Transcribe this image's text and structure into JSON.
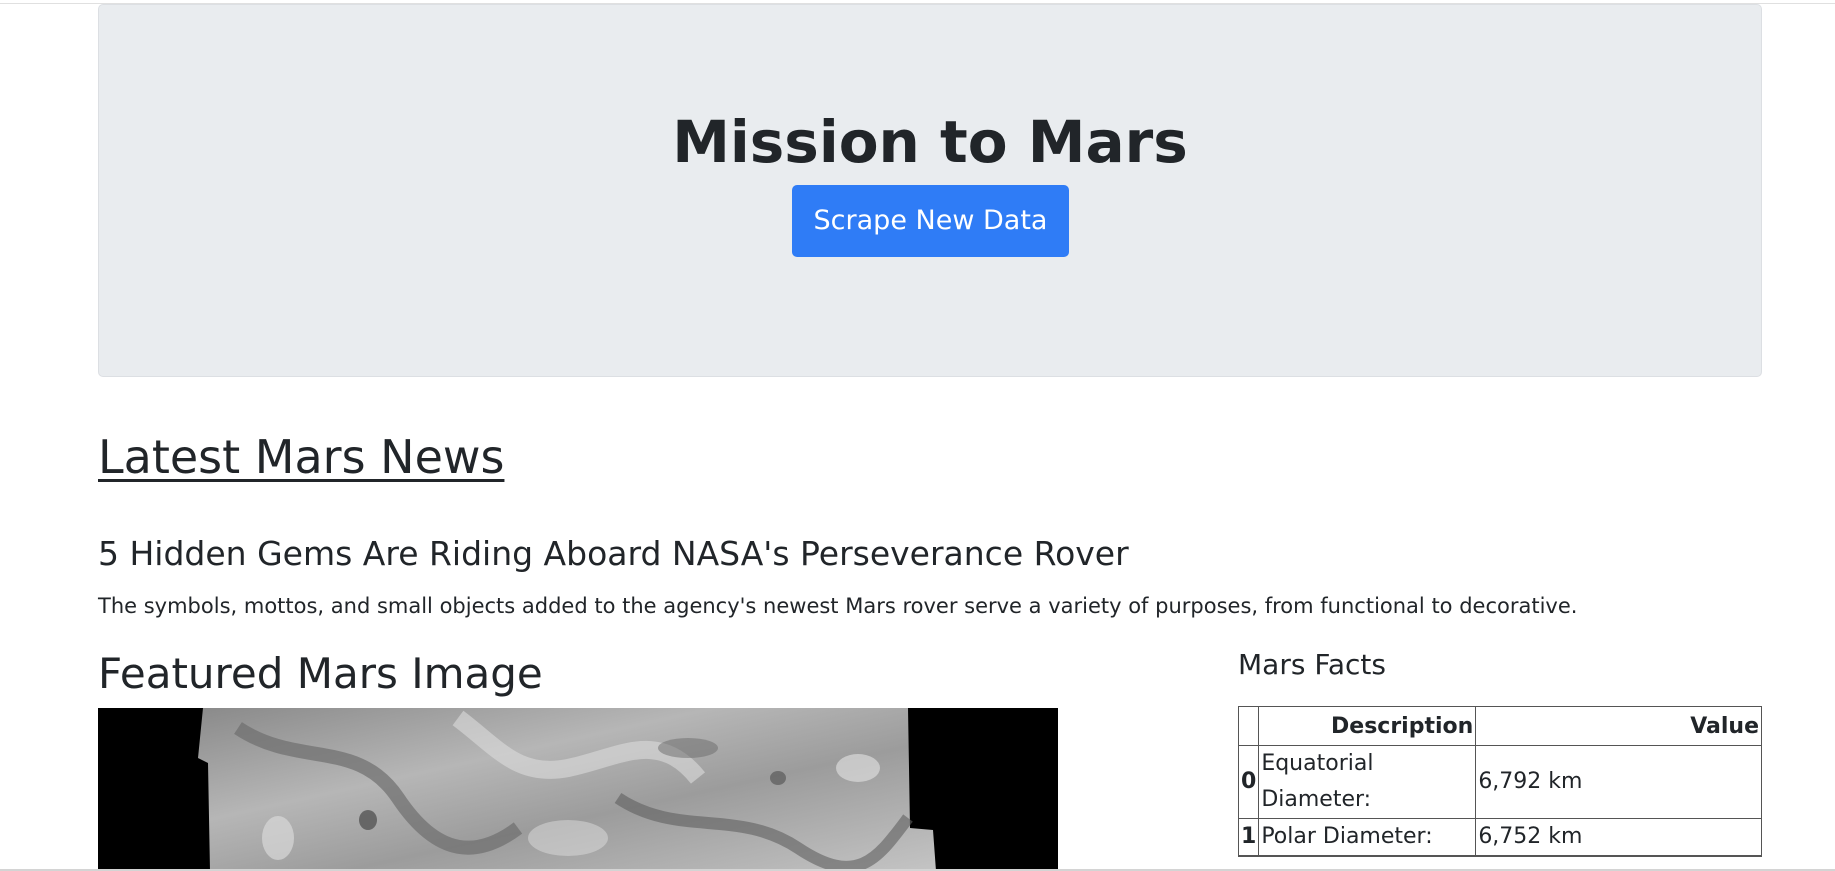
{
  "jumbotron": {
    "title": "Mission to Mars",
    "button_label": "Scrape New Data"
  },
  "news": {
    "section_title": "Latest Mars News",
    "headline": "5 Hidden Gems Are Riding Aboard NASA's Perseverance Rover",
    "teaser": "The symbols, mottos, and small objects added to the agency's newest Mars rover serve a variety of purposes, from functional to decorative."
  },
  "featured": {
    "title": "Featured Mars Image"
  },
  "facts": {
    "title": "Mars Facts",
    "headers": [
      "",
      "Description",
      "Value"
    ],
    "rows": [
      {
        "index": "0",
        "description": "Equatorial Diameter:",
        "value": "6,792 km"
      },
      {
        "index": "1",
        "description": "Polar Diameter:",
        "value": "6,752 km"
      },
      {
        "index": "",
        "description": "",
        "value": ""
      }
    ]
  }
}
